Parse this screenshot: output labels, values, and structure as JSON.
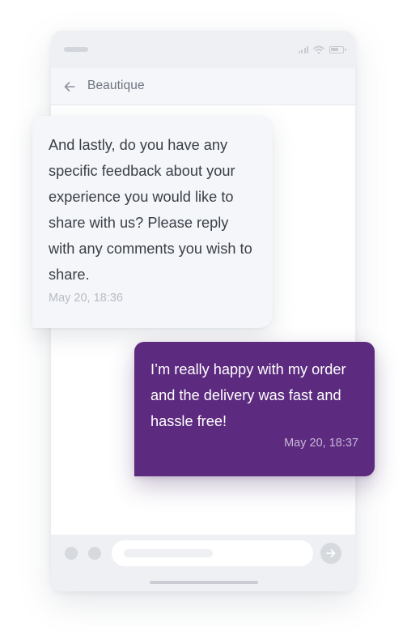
{
  "header": {
    "title": "Beautique",
    "back_icon": "arrow-left-icon"
  },
  "status_bar": {
    "icons": [
      "signal-icon",
      "wifi-icon",
      "battery-icon"
    ]
  },
  "messages": [
    {
      "direction": "incoming",
      "text": "And lastly, do you have any specific feedback about your experience you would like to share with us? Please reply with any comments you wish to share.",
      "time": "May 20, 18:36"
    },
    {
      "direction": "outgoing",
      "text": "I’m really happy with my order and the delivery was fast and hassle free!",
      "time": "May 20, 18:37"
    }
  ],
  "composer": {
    "send_icon": "arrow-right-icon"
  },
  "colors": {
    "accent": "#5c2a7e",
    "incoming_bubble": "#f4f6f9",
    "phone_frame": "#eef0f3"
  }
}
